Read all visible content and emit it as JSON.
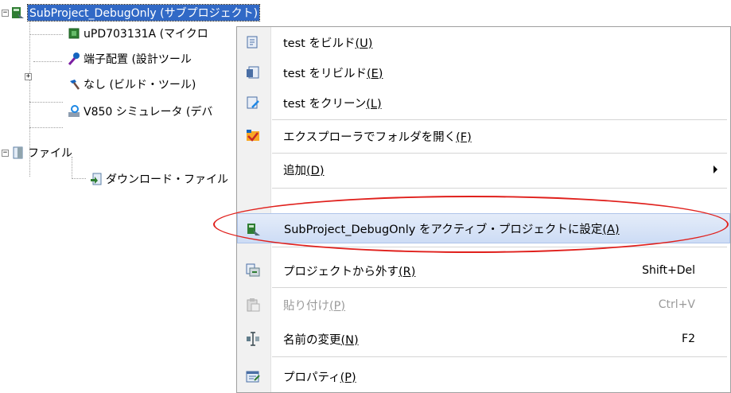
{
  "tree": {
    "project": "SubProject_DebugOnly (サブプロジェクト)",
    "device": "uPD703131A (マイクロ",
    "pin": "端子配置 (設計ツール",
    "build_tool": "なし (ビルド・ツール)",
    "debug_tool": "V850 シミュレータ (デバ",
    "files": "ファイル",
    "download": "ダウンロード・ファイル"
  },
  "menu": {
    "build": "test をビルド",
    "build_key": "(U)",
    "rebuild": "test をリビルド",
    "rebuild_key": "(E)",
    "clean": "test をクリーン",
    "clean_key": "(L)",
    "explorer": "エクスプローラでフォルダを開く",
    "explorer_key": "(F)",
    "add": "追加",
    "add_key": "(D)",
    "set_active": "SubProject_DebugOnly をアクティブ・プロジェクトに設定",
    "set_active_key": "(A)",
    "remove": "プロジェクトから外す",
    "remove_key": "(R)",
    "remove_shortcut": "Shift+Del",
    "paste": "貼り付け",
    "paste_key": "(P)",
    "paste_shortcut": "Ctrl+V",
    "rename": "名前の変更",
    "rename_key": "(N)",
    "rename_shortcut": "F2",
    "properties": "プロパティ",
    "properties_key": "(P)"
  },
  "annotation_color": "#e0201c",
  "selection_color": "#3169c6"
}
